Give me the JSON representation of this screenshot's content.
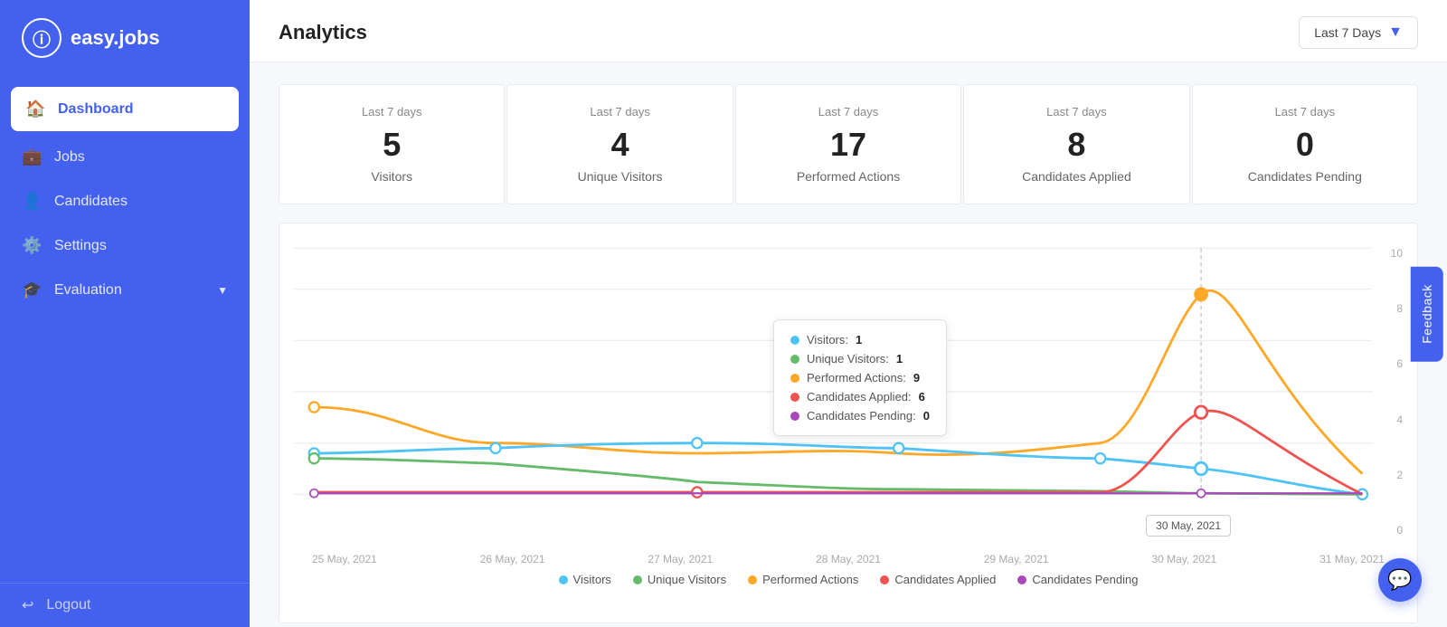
{
  "app": {
    "logo_text": "easy.jobs",
    "logo_icon": "ⓘ"
  },
  "sidebar": {
    "items": [
      {
        "id": "dashboard",
        "label": "Dashboard",
        "icon": "⌂",
        "active": true
      },
      {
        "id": "jobs",
        "label": "Jobs",
        "icon": "💼",
        "active": false
      },
      {
        "id": "candidates",
        "label": "Candidates",
        "icon": "👤",
        "active": false
      },
      {
        "id": "settings",
        "label": "Settings",
        "icon": "⚙",
        "active": false
      },
      {
        "id": "evaluation",
        "label": "Evaluation",
        "icon": "🎓",
        "active": false,
        "hasChevron": true
      }
    ],
    "logout_label": "Logout"
  },
  "header": {
    "title": "Analytics",
    "date_filter": "Last 7 Days"
  },
  "stats": [
    {
      "period": "Last 7 days",
      "value": "5",
      "label": "Visitors"
    },
    {
      "period": "Last 7 days",
      "value": "4",
      "label": "Unique Visitors"
    },
    {
      "period": "Last 7 days",
      "value": "17",
      "label": "Performed Actions"
    },
    {
      "period": "Last 7 days",
      "value": "8",
      "label": "Candidates Applied"
    },
    {
      "period": "Last 7 days",
      "value": "0",
      "label": "Candidates Pending"
    }
  ],
  "chart": {
    "x_labels": [
      "25 May, 2021",
      "26 May, 2021",
      "27 May, 2021",
      "28 May, 2021",
      "29 May, 2021",
      "30 May, 2021",
      "31 May, 2021"
    ],
    "y_labels": [
      "0",
      "2",
      "4",
      "6",
      "8",
      "10"
    ],
    "tooltip": {
      "date": "30 May, 2021",
      "items": [
        {
          "color": "#4fc3f7",
          "label": "Visitors:",
          "value": "1"
        },
        {
          "color": "#66bb6a",
          "label": "Unique Visitors:",
          "value": "1"
        },
        {
          "color": "#ffa726",
          "label": "Performed Actions:",
          "value": "9"
        },
        {
          "color": "#ef5350",
          "label": "Candidates Applied:",
          "value": "6"
        },
        {
          "color": "#ab47bc",
          "label": "Candidates Pending:",
          "value": "0"
        }
      ]
    },
    "legend": [
      {
        "color": "#4fc3f7",
        "label": "Visitors"
      },
      {
        "color": "#66bb6a",
        "label": "Unique Visitors"
      },
      {
        "color": "#ffa726",
        "label": "Performed Actions"
      },
      {
        "color": "#ef5350",
        "label": "Candidates Applied"
      },
      {
        "color": "#ab47bc",
        "label": "Candidates Pending"
      }
    ]
  },
  "feedback_label": "Feedback",
  "chat_icon": "💬"
}
